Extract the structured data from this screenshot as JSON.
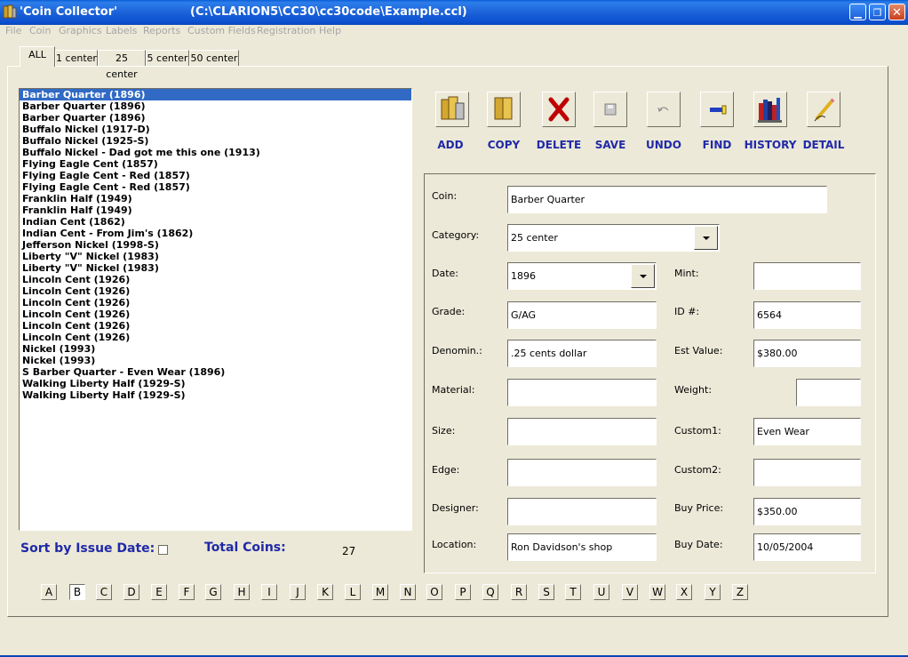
{
  "window": {
    "app_title": "'Coin Collector'",
    "file_path": "(C:\\CLARION5\\CC30\\cc30code\\Example.ccl)"
  },
  "menu": [
    "File",
    "Coin",
    "Graphics",
    "Labels",
    "Reports",
    "Custom Fields",
    "Registration",
    "Help"
  ],
  "tabs": [
    "ALL",
    "1 center",
    "25 center",
    "5 center",
    "50 center"
  ],
  "coins": [
    "Barber Quarter (1896)",
    "Barber Quarter (1896)",
    "Barber Quarter (1896)",
    "Buffalo Nickel (1917-D)",
    "Buffalo Nickel (1925-S)",
    "Buffalo Nickel - Dad got me this one (1913)",
    "Flying Eagle Cent (1857)",
    "Flying Eagle Cent - Red (1857)",
    "Flying Eagle Cent - Red (1857)",
    "Franklin Half (1949)",
    "Franklin Half (1949)",
    "Indian Cent (1862)",
    "Indian Cent - From Jim's (1862)",
    "Jefferson Nickel (1998-S)",
    "Liberty \"V\" Nickel (1983)",
    "Liberty \"V\" Nickel (1983)",
    "Lincoln Cent (1926)",
    "Lincoln Cent (1926)",
    "Lincoln Cent (1926)",
    "Lincoln Cent (1926)",
    "Lincoln Cent (1926)",
    "Lincoln Cent (1926)",
    "Nickel (1993)",
    "Nickel (1993)",
    "S Barber Quarter - Even Wear (1896)",
    "Walking Liberty Half (1929-S)",
    "Walking Liberty Half (1929-S)"
  ],
  "selected_coin_index": 0,
  "toolbar": {
    "add": "ADD",
    "copy": "COPY",
    "delete": "DELETE",
    "save": "SAVE",
    "undo": "UNDO",
    "find": "FIND",
    "history": "HISTORY",
    "detail": "DETAIL"
  },
  "form": {
    "coin_label": "Coin:",
    "coin_value": "Barber Quarter",
    "category_label": "Category:",
    "category_value": "25 center",
    "date_label": "Date:",
    "date_value": "1896",
    "mint_label": "Mint:",
    "mint_value": "",
    "grade_label": "Grade:",
    "grade_value": "G/AG",
    "id_label": "ID #:",
    "id_value": "6564",
    "denomin_label": "Denomin.:",
    "denomin_value": ".25 cents dollar",
    "estvalue_label": "Est Value:",
    "estvalue_value": "$380.00",
    "material_label": "Material:",
    "material_value": "",
    "weight_label": "Weight:",
    "weight_value": "",
    "size_label": "Size:",
    "size_value": "",
    "custom1_label": "Custom1:",
    "custom1_value": "Even Wear",
    "edge_label": "Edge:",
    "edge_value": "",
    "custom2_label": "Custom2:",
    "custom2_value": "",
    "designer_label": "Designer:",
    "designer_value": "",
    "buyprice_label": "Buy Price:",
    "buyprice_value": "$350.00",
    "location_label": "Location:",
    "location_value": "Ron Davidson's shop",
    "buydate_label": "Buy Date:",
    "buydate_value": "10/05/2004"
  },
  "footer": {
    "sort_label": "Sort by Issue Date:",
    "total_label": "Total Coins:",
    "total_value": "27"
  },
  "alphabet": [
    "A",
    "B",
    "C",
    "D",
    "E",
    "F",
    "G",
    "H",
    "I",
    "J",
    "K",
    "L",
    "M",
    "N",
    "O",
    "P",
    "Q",
    "R",
    "S",
    "T",
    "U",
    "V",
    "W",
    "X",
    "Y",
    "Z"
  ],
  "alphabet_pressed": "B"
}
